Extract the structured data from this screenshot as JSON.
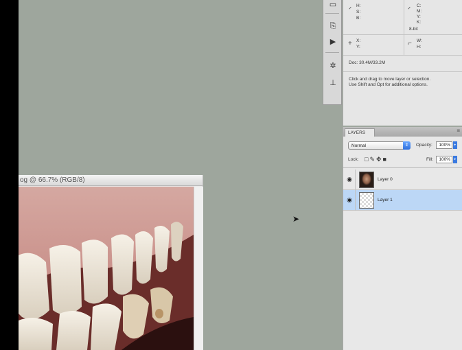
{
  "document": {
    "title": "og @ 66.7% (RGB/8)"
  },
  "tools": {
    "icons": [
      "ruler-icon",
      "history-icon",
      "actions-icon",
      "brush-icon",
      "clone-source-icon"
    ]
  },
  "info": {
    "color_left": {
      "h": "H:",
      "s": "S:",
      "b": "B:"
    },
    "color_right": {
      "c": "C:",
      "m": "M:",
      "y": "Y:",
      "k": "K:",
      "depth": "8-bit"
    },
    "position": {
      "x": "X:",
      "y": "Y:"
    },
    "size": {
      "w": "W:",
      "h": "H:"
    },
    "doc": "Doc: 30.4M/33.2M",
    "hint_line1": "Click and drag to move layer or selection.",
    "hint_line2": "Use Shift and Opt for additional options."
  },
  "layers": {
    "tab_label": "LAYERS",
    "blend_mode": "Normal",
    "opacity_label": "Opacity:",
    "opacity_value": "100%",
    "lock_label": "Lock:",
    "fill_label": "Fill:",
    "fill_value": "100%",
    "items": [
      {
        "name": "Layer 0",
        "selected": false
      },
      {
        "name": "Layer 1",
        "selected": true
      }
    ]
  },
  "colors": {
    "workspace": "#9ea69d",
    "selection": "#bcd7f6",
    "accent": "#2f6fdc"
  }
}
